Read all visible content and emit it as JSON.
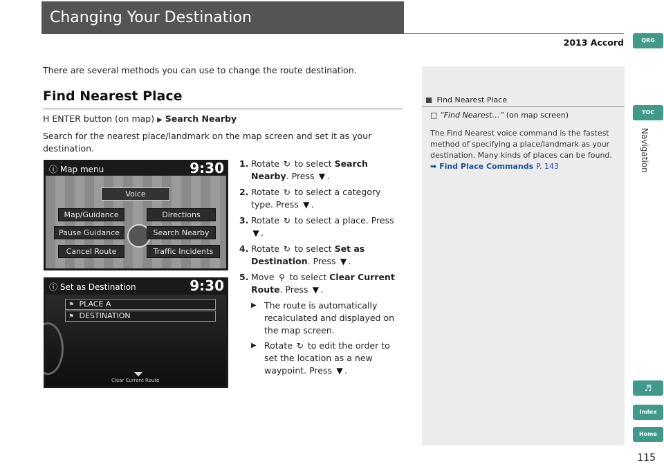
{
  "header": {
    "title": "Changing Your Destination",
    "car_model": "2013 Accord"
  },
  "intro": "There are several methods you can use to change the route destination.",
  "section": {
    "heading": "Find Nearest Place",
    "path_prefix": "ENTER button (on map)",
    "path_target": "Search Nearby",
    "description": "Search for the nearest place/landmark on the map screen and set it as your destination."
  },
  "screen1": {
    "title": "Map menu",
    "time": "9:30",
    "buttons": {
      "voice": "Voice",
      "map_guidance": "Map/Guidance",
      "directions": "Directions",
      "pause_guidance": "Pause Guidance",
      "search_nearby": "Search Nearby",
      "cancel_route": "Cancel Route",
      "traffic_incidents": "Traffic Incidents"
    }
  },
  "screen2": {
    "title": "Set as Destination",
    "time": "9:30",
    "rows": [
      "PLACE A",
      "DESTINATION"
    ],
    "footer": "Clear Current Route"
  },
  "steps": [
    {
      "num": "1.",
      "a": "Rotate",
      "b": "to select",
      "bold": "Search Nearby",
      "c": ". Press",
      "d": "."
    },
    {
      "num": "2.",
      "a": "Rotate",
      "b": "to select a category type. Press",
      "d": "."
    },
    {
      "num": "3.",
      "a": "Rotate",
      "b": "to select a place. Press",
      "d": "."
    },
    {
      "num": "4.",
      "a": "Rotate",
      "b": "to select",
      "bold": "Set as Destination",
      "c": ". Press",
      "d": "."
    },
    {
      "num": "5.",
      "a": "Move",
      "b": "to select",
      "bold": "Clear Current Route",
      "c": ". Press",
      "d": "."
    }
  ],
  "sub_notes": {
    "note1": "The route is automatically recalculated and displayed on the map screen.",
    "note2_a": "Rotate",
    "note2_b": "to edit the order to set the location as a new waypoint. Press",
    "note2_c": "."
  },
  "sidebar": {
    "heading": "Find Nearest Place",
    "voice_cmd": "“Find Nearest…”",
    "voice_ctx": "(on map screen)",
    "text": "The Find Nearest voice command is the fastest method of specifying a place/landmark as your destination. Many kinds of places can be found.",
    "link_label": "Find Place Commands",
    "link_page": "P. 143"
  },
  "tabs": {
    "qrg": "QRG",
    "toc": "TOC",
    "index": "Index",
    "home": "Home",
    "voice_icon": "voice-icon"
  },
  "section_tab": "Navigation",
  "page_number": "115"
}
